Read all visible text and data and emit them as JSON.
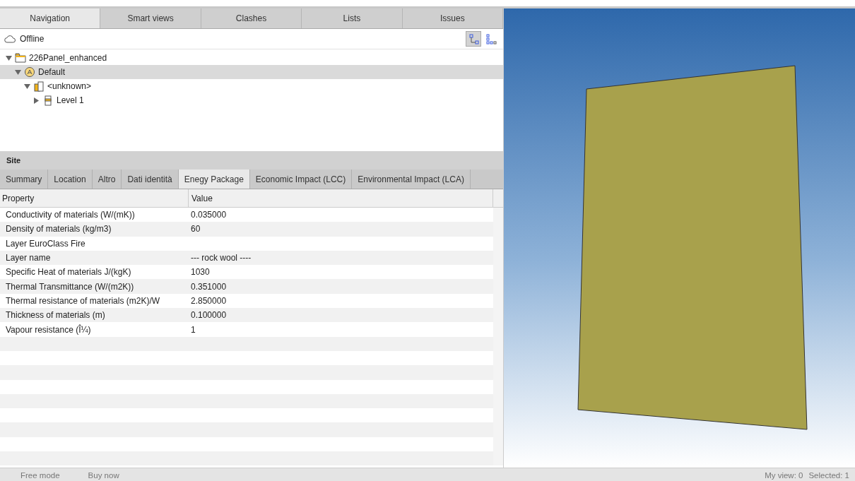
{
  "top_tabs": [
    {
      "label": "Navigation",
      "selected": true
    },
    {
      "label": "Smart views",
      "selected": false
    },
    {
      "label": "Clashes",
      "selected": false
    },
    {
      "label": "Lists",
      "selected": false
    },
    {
      "label": "Issues",
      "selected": false
    }
  ],
  "connection": {
    "label": "Offline"
  },
  "view_toggles": [
    {
      "kind": "tree",
      "selected": true
    },
    {
      "kind": "grid",
      "selected": false
    }
  ],
  "tree": [
    {
      "label": "226Panel_enhanced",
      "kind": "folder",
      "expanded": true,
      "selected": false,
      "children": [
        {
          "label": "Default",
          "kind": "site",
          "expanded": true,
          "selected": true,
          "children": [
            {
              "label": "<unknown>",
              "kind": "building",
              "expanded": true,
              "selected": false,
              "children": [
                {
                  "label": "Level 1",
                  "kind": "level",
                  "expanded": false,
                  "selected": false
                }
              ]
            }
          ]
        }
      ]
    }
  ],
  "properties_title": "Site",
  "property_tabs": [
    {
      "label": "Summary",
      "selected": false
    },
    {
      "label": "Location",
      "selected": false
    },
    {
      "label": "Altro",
      "selected": false
    },
    {
      "label": "Dati identità",
      "selected": false
    },
    {
      "label": "Enegy Package",
      "selected": true
    },
    {
      "label": "Economic Impact (LCC)",
      "selected": false
    },
    {
      "label": "Environmental Impact (LCA)",
      "selected": false
    }
  ],
  "table": {
    "columns": [
      "Property",
      "Value"
    ],
    "rows": [
      [
        "Conductivity of materials (W/(mK))",
        "0.035000"
      ],
      [
        "Density of materials (kg/m3)",
        "60"
      ],
      [
        "Layer EuroClass Fire",
        ""
      ],
      [
        "Layer name",
        "--- rock wool ----"
      ],
      [
        "Specific Heat of materials J/(kgK)",
        "1030"
      ],
      [
        "Thermal Transmittance (W/(m2K))",
        "0.351000"
      ],
      [
        "Thermal resistance of materials (m2K)/W",
        "2.850000"
      ],
      [
        "Thickness of materials (m)",
        "0.100000"
      ],
      [
        "Vapour resistance (Î¼)",
        "1"
      ]
    ]
  },
  "status_bar": {
    "left": [
      "Free mode",
      "Buy now"
    ],
    "right": [
      "My view: 0",
      "Selected: 1"
    ]
  }
}
